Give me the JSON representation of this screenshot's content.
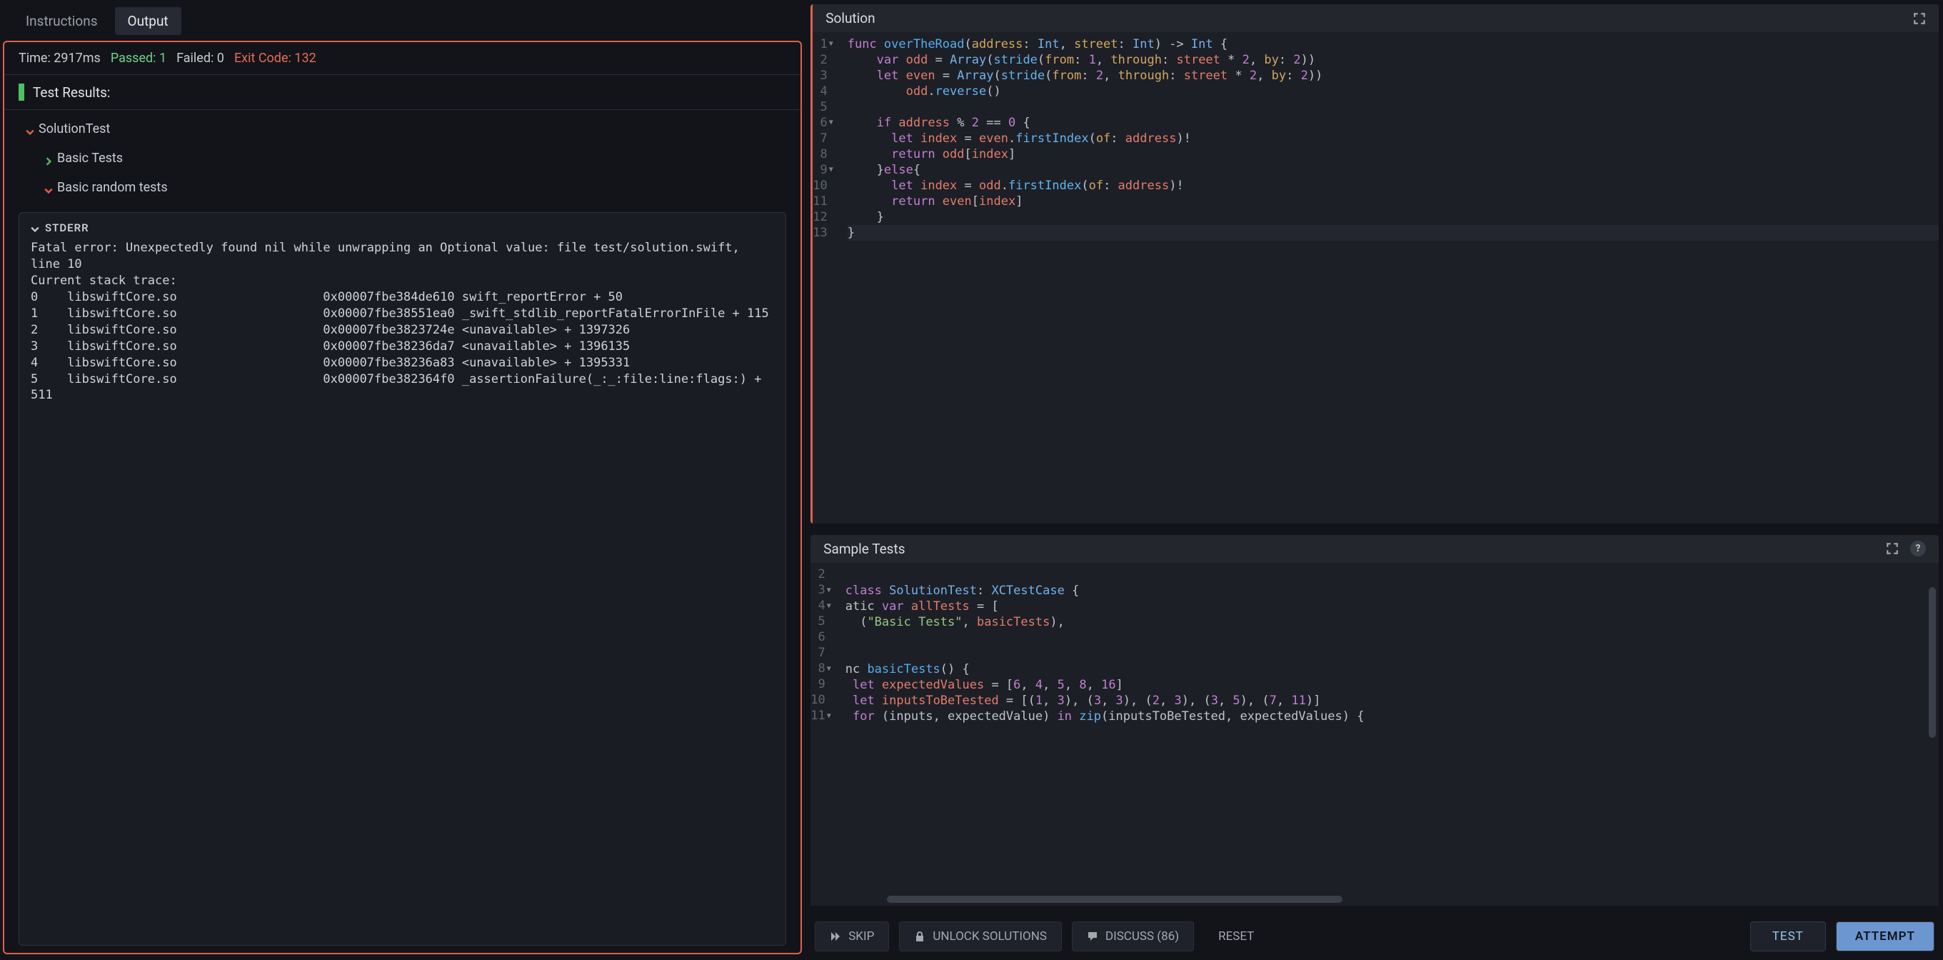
{
  "tabs": {
    "instructions": "Instructions",
    "output": "Output"
  },
  "status": {
    "time_label": "Time: 2917ms",
    "passed_label": "Passed: 1",
    "failed_label": "Failed: 0",
    "exit_label": "Exit Code: 132"
  },
  "results_title": "Test Results:",
  "tree": {
    "suite": "SolutionTest",
    "basic": "Basic Tests",
    "random": "Basic random tests"
  },
  "stderr": {
    "title": "STDERR",
    "body": "Fatal error: Unexpectedly found nil while unwrapping an Optional value: file test/solution.swift, line 10\nCurrent stack trace:\n0    libswiftCore.so                    0x00007fbe384de610 swift_reportError + 50\n1    libswiftCore.so                    0x00007fbe38551ea0 _swift_stdlib_reportFatalErrorInFile + 115\n2    libswiftCore.so                    0x00007fbe3823724e <unavailable> + 1397326\n3    libswiftCore.so                    0x00007fbe38236da7 <unavailable> + 1396135\n4    libswiftCore.so                    0x00007fbe38236a83 <unavailable> + 1395331\n5    libswiftCore.so                    0x00007fbe382364f0 _assertionFailure(_:_:file:line:flags:) + 511"
  },
  "panels": {
    "solution": "Solution",
    "sample": "Sample Tests"
  },
  "buttons": {
    "skip": "SKIP",
    "unlock": "UNLOCK SOLUTIONS",
    "discuss": "DISCUSS (86)",
    "reset": "RESET",
    "test": "TEST",
    "attempt": "ATTEMPT"
  },
  "code_solution": {
    "fold_lines": [
      1,
      6,
      9
    ],
    "lines": 13,
    "tokens": [
      [
        [
          "kw",
          "func "
        ],
        [
          "fn",
          "overTheRoad"
        ],
        [
          "pn",
          "("
        ],
        [
          "arg",
          "address"
        ],
        [
          "pn",
          ": "
        ],
        [
          "type",
          "Int"
        ],
        [
          "pn",
          ", "
        ],
        [
          "arg",
          "street"
        ],
        [
          "pn",
          ": "
        ],
        [
          "type",
          "Int"
        ],
        [
          "pn",
          ") -> "
        ],
        [
          "type",
          "Int"
        ],
        [
          "pn",
          " {"
        ]
      ],
      [
        [
          "pn",
          "    "
        ],
        [
          "kw",
          "var "
        ],
        [
          "id",
          "odd"
        ],
        [
          "pn",
          " = "
        ],
        [
          "type",
          "Array"
        ],
        [
          "pn",
          "("
        ],
        [
          "mth",
          "stride"
        ],
        [
          "pn",
          "("
        ],
        [
          "arg",
          "from"
        ],
        [
          "pn",
          ": "
        ],
        [
          "num",
          "1"
        ],
        [
          "pn",
          ", "
        ],
        [
          "arg",
          "through"
        ],
        [
          "pn",
          ": "
        ],
        [
          "id",
          "street"
        ],
        [
          "pn",
          " * "
        ],
        [
          "num",
          "2"
        ],
        [
          "pn",
          ", "
        ],
        [
          "arg",
          "by"
        ],
        [
          "pn",
          ": "
        ],
        [
          "num",
          "2"
        ],
        [
          "pn",
          "))"
        ]
      ],
      [
        [
          "pn",
          "    "
        ],
        [
          "kw",
          "let "
        ],
        [
          "id",
          "even"
        ],
        [
          "pn",
          " = "
        ],
        [
          "type",
          "Array"
        ],
        [
          "pn",
          "("
        ],
        [
          "mth",
          "stride"
        ],
        [
          "pn",
          "("
        ],
        [
          "arg",
          "from"
        ],
        [
          "pn",
          ": "
        ],
        [
          "num",
          "2"
        ],
        [
          "pn",
          ", "
        ],
        [
          "arg",
          "through"
        ],
        [
          "pn",
          ": "
        ],
        [
          "id",
          "street"
        ],
        [
          "pn",
          " * "
        ],
        [
          "num",
          "2"
        ],
        [
          "pn",
          ", "
        ],
        [
          "arg",
          "by"
        ],
        [
          "pn",
          ": "
        ],
        [
          "num",
          "2"
        ],
        [
          "pn",
          "))"
        ]
      ],
      [
        [
          "pn",
          "        "
        ],
        [
          "id",
          "odd"
        ],
        [
          "pn",
          "."
        ],
        [
          "mth",
          "reverse"
        ],
        [
          "pn",
          "()"
        ]
      ],
      [],
      [
        [
          "pn",
          "    "
        ],
        [
          "kw",
          "if "
        ],
        [
          "id",
          "address"
        ],
        [
          "pn",
          " % "
        ],
        [
          "num",
          "2"
        ],
        [
          "pn",
          " == "
        ],
        [
          "num",
          "0"
        ],
        [
          "pn",
          " {"
        ]
      ],
      [
        [
          "pn",
          "      "
        ],
        [
          "kw",
          "let "
        ],
        [
          "id",
          "index"
        ],
        [
          "pn",
          " = "
        ],
        [
          "id",
          "even"
        ],
        [
          "pn",
          "."
        ],
        [
          "mth",
          "firstIndex"
        ],
        [
          "pn",
          "("
        ],
        [
          "arg",
          "of"
        ],
        [
          "pn",
          ": "
        ],
        [
          "id",
          "address"
        ],
        [
          "pn",
          ")!"
        ]
      ],
      [
        [
          "pn",
          "      "
        ],
        [
          "kw",
          "return "
        ],
        [
          "id",
          "odd"
        ],
        [
          "pn",
          "["
        ],
        [
          "id",
          "index"
        ],
        [
          "pn",
          "]"
        ]
      ],
      [
        [
          "pn",
          "    }"
        ],
        [
          "kw",
          "else"
        ],
        [
          "pn",
          "{"
        ]
      ],
      [
        [
          "pn",
          "      "
        ],
        [
          "kw",
          "let "
        ],
        [
          "id",
          "index"
        ],
        [
          "pn",
          " = "
        ],
        [
          "id",
          "odd"
        ],
        [
          "pn",
          "."
        ],
        [
          "mth",
          "firstIndex"
        ],
        [
          "pn",
          "("
        ],
        [
          "arg",
          "of"
        ],
        [
          "pn",
          ": "
        ],
        [
          "id",
          "address"
        ],
        [
          "pn",
          ")!"
        ]
      ],
      [
        [
          "pn",
          "      "
        ],
        [
          "kw",
          "return "
        ],
        [
          "id",
          "even"
        ],
        [
          "pn",
          "["
        ],
        [
          "id",
          "index"
        ],
        [
          "pn",
          "]"
        ]
      ],
      [
        [
          "pn",
          "    }"
        ]
      ],
      [
        [
          "pn",
          "}"
        ]
      ]
    ],
    "highlight": 13
  },
  "code_sample": {
    "start": 2,
    "fold_lines": [
      3,
      4,
      8,
      11
    ],
    "tokens": [
      [],
      [
        [
          "kw",
          "class "
        ],
        [
          "type",
          "SolutionTest"
        ],
        [
          "pn",
          ": "
        ],
        [
          "type",
          "XCTestCase"
        ],
        [
          "pn",
          " {"
        ]
      ],
      [
        [
          "pn",
          "atic "
        ],
        [
          "kw",
          "var "
        ],
        [
          "id",
          "allTests"
        ],
        [
          "pn",
          " = ["
        ]
      ],
      [
        [
          "pn",
          "  ("
        ],
        [
          "str",
          "\"Basic Tests\""
        ],
        [
          "pn",
          ", "
        ],
        [
          "id",
          "basicTests"
        ],
        [
          "pn",
          "),"
        ]
      ],
      [],
      [],
      [
        [
          "pn",
          "nc "
        ],
        [
          "fn",
          "basicTests"
        ],
        [
          "pn",
          "() {"
        ]
      ],
      [
        [
          "pn",
          " "
        ],
        [
          "kw",
          "let "
        ],
        [
          "id",
          "expectedValues"
        ],
        [
          "pn",
          " = ["
        ],
        [
          "num",
          "6"
        ],
        [
          "pn",
          ", "
        ],
        [
          "num",
          "4"
        ],
        [
          "pn",
          ", "
        ],
        [
          "num",
          "5"
        ],
        [
          "pn",
          ", "
        ],
        [
          "num",
          "8"
        ],
        [
          "pn",
          ", "
        ],
        [
          "num",
          "16"
        ],
        [
          "pn",
          "]"
        ]
      ],
      [
        [
          "pn",
          " "
        ],
        [
          "kw",
          "let "
        ],
        [
          "id",
          "inputsToBeTested"
        ],
        [
          "pn",
          " = [("
        ],
        [
          "num",
          "1"
        ],
        [
          "pn",
          ", "
        ],
        [
          "num",
          "3"
        ],
        [
          "pn",
          "), ("
        ],
        [
          "num",
          "3"
        ],
        [
          "pn",
          ", "
        ],
        [
          "num",
          "3"
        ],
        [
          "pn",
          "), ("
        ],
        [
          "num",
          "2"
        ],
        [
          "pn",
          ", "
        ],
        [
          "num",
          "3"
        ],
        [
          "pn",
          "), ("
        ],
        [
          "num",
          "3"
        ],
        [
          "pn",
          ", "
        ],
        [
          "num",
          "5"
        ],
        [
          "pn",
          "), ("
        ],
        [
          "num",
          "7"
        ],
        [
          "pn",
          ", "
        ],
        [
          "num",
          "11"
        ],
        [
          "pn",
          ")]"
        ]
      ],
      [
        [
          "pn",
          " "
        ],
        [
          "kw",
          "for "
        ],
        [
          "pn",
          "(inputs, expectedValue) "
        ],
        [
          "kw",
          "in "
        ],
        [
          "mth",
          "zip"
        ],
        [
          "pn",
          "(inputsToBeTested, expectedValues) {"
        ]
      ]
    ]
  }
}
